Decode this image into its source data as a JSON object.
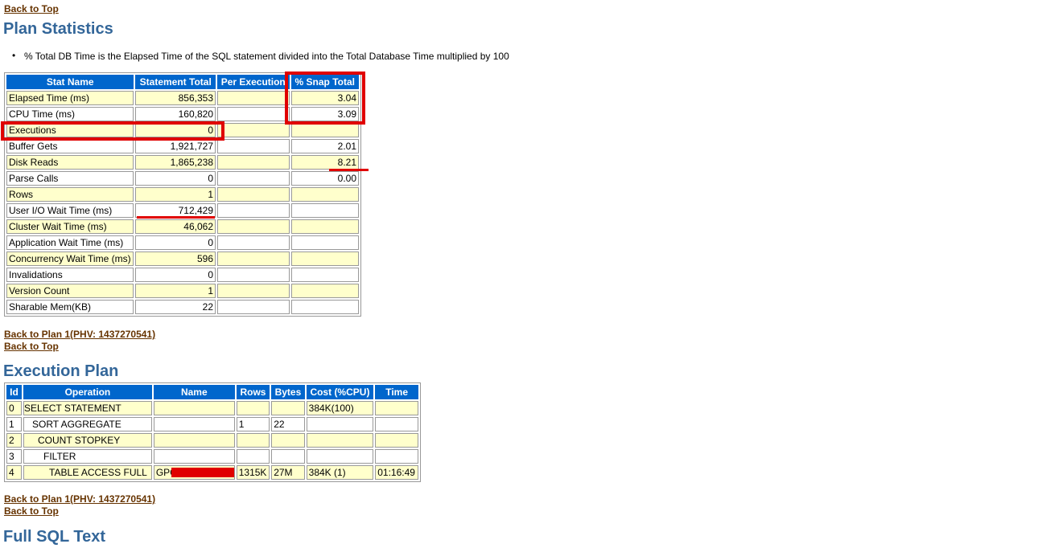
{
  "links": {
    "back_to_top_1": "Back to Top",
    "back_to_plan_1": "Back to Plan 1(PHV: 1437270541)",
    "back_to_top_2": "Back to Top",
    "back_to_plan_2": "Back to Plan 1(PHV: 1437270541)",
    "back_to_top_3": "Back to Top"
  },
  "sections": {
    "plan_statistics": "Plan Statistics",
    "execution_plan": "Execution Plan",
    "full_sql_text": "Full SQL Text"
  },
  "note": "% Total DB Time is the Elapsed Time of the SQL statement divided into the Total Database Time multiplied by 100",
  "stats": {
    "headers": [
      "Stat Name",
      "Statement Total",
      "Per Execution",
      "% Snap Total"
    ],
    "rows": [
      {
        "name": "Elapsed Time (ms)",
        "total": "856,353",
        "per_exec": "",
        "snap": "3.04"
      },
      {
        "name": "CPU Time (ms)",
        "total": "160,820",
        "per_exec": "",
        "snap": "3.09"
      },
      {
        "name": "Executions",
        "total": "0",
        "per_exec": "",
        "snap": ""
      },
      {
        "name": "Buffer Gets",
        "total": "1,921,727",
        "per_exec": "",
        "snap": "2.01"
      },
      {
        "name": "Disk Reads",
        "total": "1,865,238",
        "per_exec": "",
        "snap": "8.21"
      },
      {
        "name": "Parse Calls",
        "total": "0",
        "per_exec": "",
        "snap": "0.00"
      },
      {
        "name": "Rows",
        "total": "1",
        "per_exec": "",
        "snap": ""
      },
      {
        "name": "User I/O Wait Time (ms)",
        "total": "712,429",
        "per_exec": "",
        "snap": ""
      },
      {
        "name": "Cluster Wait Time (ms)",
        "total": "46,062",
        "per_exec": "",
        "snap": ""
      },
      {
        "name": "Application Wait Time (ms)",
        "total": "0",
        "per_exec": "",
        "snap": ""
      },
      {
        "name": "Concurrency Wait Time (ms)",
        "total": "596",
        "per_exec": "",
        "snap": ""
      },
      {
        "name": "Invalidations",
        "total": "0",
        "per_exec": "",
        "snap": ""
      },
      {
        "name": "Version Count",
        "total": "1",
        "per_exec": "",
        "snap": ""
      },
      {
        "name": "Sharable Mem(KB)",
        "total": "22",
        "per_exec": "",
        "snap": ""
      }
    ]
  },
  "plan": {
    "headers": [
      "Id",
      "Operation",
      "Name",
      "Rows",
      "Bytes",
      "Cost (%CPU)",
      "Time"
    ],
    "rows": [
      {
        "id": "0",
        "op": "SELECT STATEMENT",
        "name": "",
        "rows": "",
        "bytes": "",
        "cost": "384K(100)",
        "time": ""
      },
      {
        "id": "1",
        "op": "SORT AGGREGATE",
        "name": "",
        "rows": "1",
        "bytes": "22",
        "cost": "",
        "time": ""
      },
      {
        "id": "2",
        "op": "COUNT STOPKEY",
        "name": "",
        "rows": "",
        "bytes": "",
        "cost": "",
        "time": ""
      },
      {
        "id": "3",
        "op": "FILTER",
        "name": "",
        "rows": "",
        "bytes": "",
        "cost": "",
        "time": ""
      },
      {
        "id": "4",
        "op": "TABLE ACCESS FULL",
        "name": "GPC",
        "rows": "1315K",
        "bytes": "27M",
        "cost": "384K (1)",
        "time": "01:16:49"
      }
    ]
  },
  "colors": {
    "header_bg": "#0066cc",
    "odd_row_bg": "#ffffcc",
    "section_title": "#336699",
    "link": "#663300",
    "annotation": "#e00000"
  }
}
